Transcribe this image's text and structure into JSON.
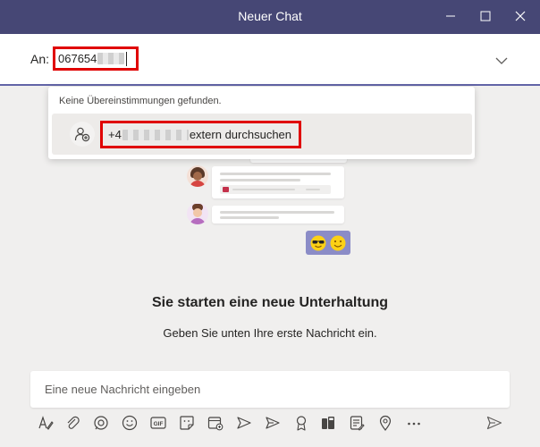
{
  "window": {
    "title": "Neuer Chat"
  },
  "to_bar": {
    "label": "An:",
    "value": "067654"
  },
  "dropdown": {
    "message": "Keine Übereinstimmungen gefunden.",
    "search_prefix": "+4",
    "search_suffix": "extern durchsuchen"
  },
  "empty_state": {
    "heading": "Sie starten eine neue Unterhaltung",
    "subtext": "Geben Sie unten Ihre erste Nachricht ein."
  },
  "compose": {
    "placeholder": "Eine neue Nachricht eingeben"
  },
  "toolbar": {
    "gif_label": "GIF",
    "icons": [
      "format-icon",
      "attach-icon",
      "loop-icon",
      "emoji-icon",
      "gif-icon",
      "sticker-icon",
      "schedule-meeting-icon",
      "stream-icon",
      "praise-icon",
      "apps-icon",
      "tasks-icon",
      "location-icon",
      "more-icon",
      "send-icon"
    ]
  },
  "colors": {
    "titlebar": "#464775",
    "accent": "#6264a7",
    "highlight": "#e00000",
    "background": "#f0efee"
  }
}
